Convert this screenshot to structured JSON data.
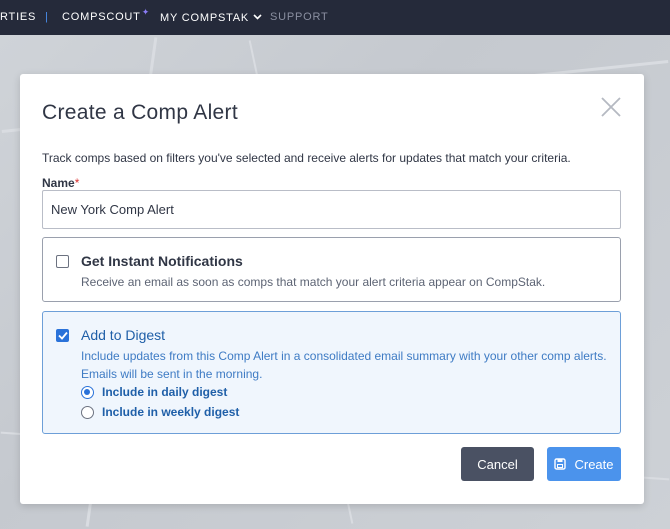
{
  "nav": {
    "properties": "RTIES",
    "separator": "|",
    "compscout": "COMPSCOUT",
    "compscout_badge": "✦",
    "my_compstak": "MY COMPSTAK",
    "support": "SUPPORT"
  },
  "modal": {
    "title": "Create a Comp Alert",
    "close_icon": "close-icon",
    "description": "Track comps based on filters you've selected and receive alerts for updates that match your criteria.",
    "name_label": "Name",
    "name_required_mark": "*",
    "name_value": "New York Comp Alert",
    "instant": {
      "checked": false,
      "title": "Get Instant Notifications",
      "description": "Receive an email as soon as comps that match your alert criteria appear on CompStak."
    },
    "digest": {
      "checked": true,
      "title": "Add to Digest",
      "description": "Include updates from this Comp Alert in a consolidated email summary with your other comp alerts. Emails will be sent in the morning.",
      "options": [
        {
          "label": "Include in daily digest",
          "selected": true
        },
        {
          "label": "Include in weekly digest",
          "selected": false
        }
      ]
    },
    "cancel_label": "Cancel",
    "create_label": "Create",
    "create_icon": "save-icon"
  },
  "colors": {
    "nav_bg": "#252a3a",
    "accent": "#2a72d9",
    "cancel_bg": "#4a5163",
    "create_bg": "#4b93ec"
  }
}
